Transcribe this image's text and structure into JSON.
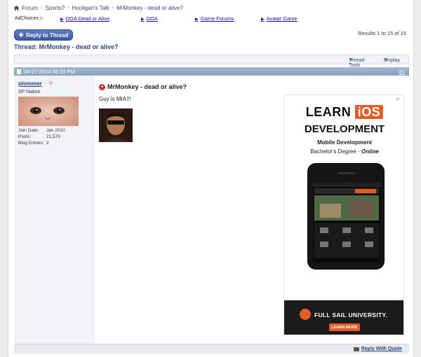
{
  "breadcrumb": {
    "items": [
      "Forum",
      "Sports?",
      "Hooligan's Talk",
      "MrMonkey - dead or alive?"
    ]
  },
  "ads_row": {
    "adchoices_label": "AdChoices",
    "links": [
      "DOA Dead or Alive",
      "DOA",
      "Game Forums",
      "Avatar Game"
    ]
  },
  "toolbar": {
    "reply_label": "Reply to Thread",
    "results": "Results 1 to 15 of 15",
    "thread_title": "Thread: MrMonkey - dead or alive?",
    "thread_tools": "Thread Tools",
    "display": "Display"
  },
  "post": {
    "date": "04-27-2014 08:19 PM",
    "number": "#1",
    "username": "plommer",
    "user_title": "SP Nation",
    "stats": [
      {
        "k": "Join Date:",
        "v": "Jan 2010"
      },
      {
        "k": "Posts:",
        "v": "21,579"
      },
      {
        "k": "Blog Entries:",
        "v": "2"
      }
    ],
    "title": "MrMonkey - dead or alive?",
    "text": "Guy is MIA!!!",
    "reply_with_quote": "Reply With Quote"
  },
  "ad": {
    "learn": "LEARN",
    "ios": "iOS",
    "development": "DEVELOPMENT",
    "mobile": "Mobile Development",
    "degree_prefix": "Bachelor's Degree - ",
    "degree_suffix": "Online",
    "brand": "FULL SAIL UNIVERSITY.",
    "cta": "LEARN MORE"
  },
  "colors": {
    "accent": "#3a5aa3",
    "header_bar": "#8aa1bf",
    "ad_orange": "#e55d26"
  }
}
